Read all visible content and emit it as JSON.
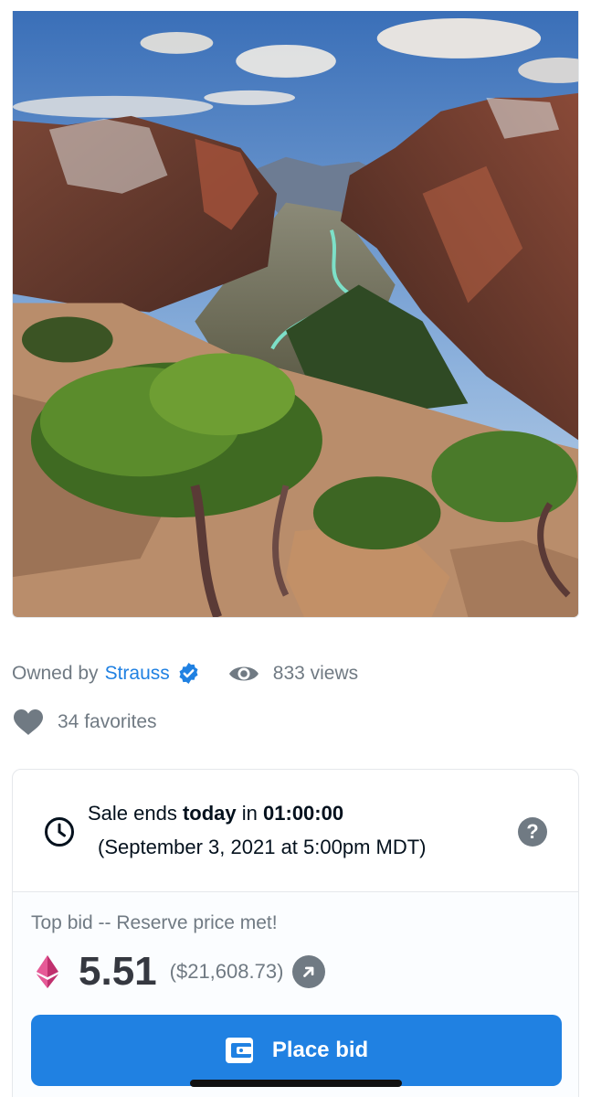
{
  "artwork": {
    "icon": "canyon-landscape-image"
  },
  "owner": {
    "label": "Owned by",
    "name": "Strauss",
    "verified_icon": "verified-badge-icon"
  },
  "stats": {
    "views": "833 views",
    "favorites": "34 favorites"
  },
  "sale": {
    "prefix": "Sale ends ",
    "today": "today",
    "middle": " in ",
    "countdown": "01:00:00",
    "date": "(September 3, 2021 at 5:00pm MDT)",
    "help": "?"
  },
  "bid": {
    "label": "Top bid -- Reserve price met!",
    "price": "5.51",
    "usd": "($21,608.73)",
    "currency_icon": "ethereum-icon",
    "button_label": "Place bid"
  },
  "colors": {
    "accent": "#2081e2",
    "muted": "#707a83",
    "text": "#04111d"
  }
}
